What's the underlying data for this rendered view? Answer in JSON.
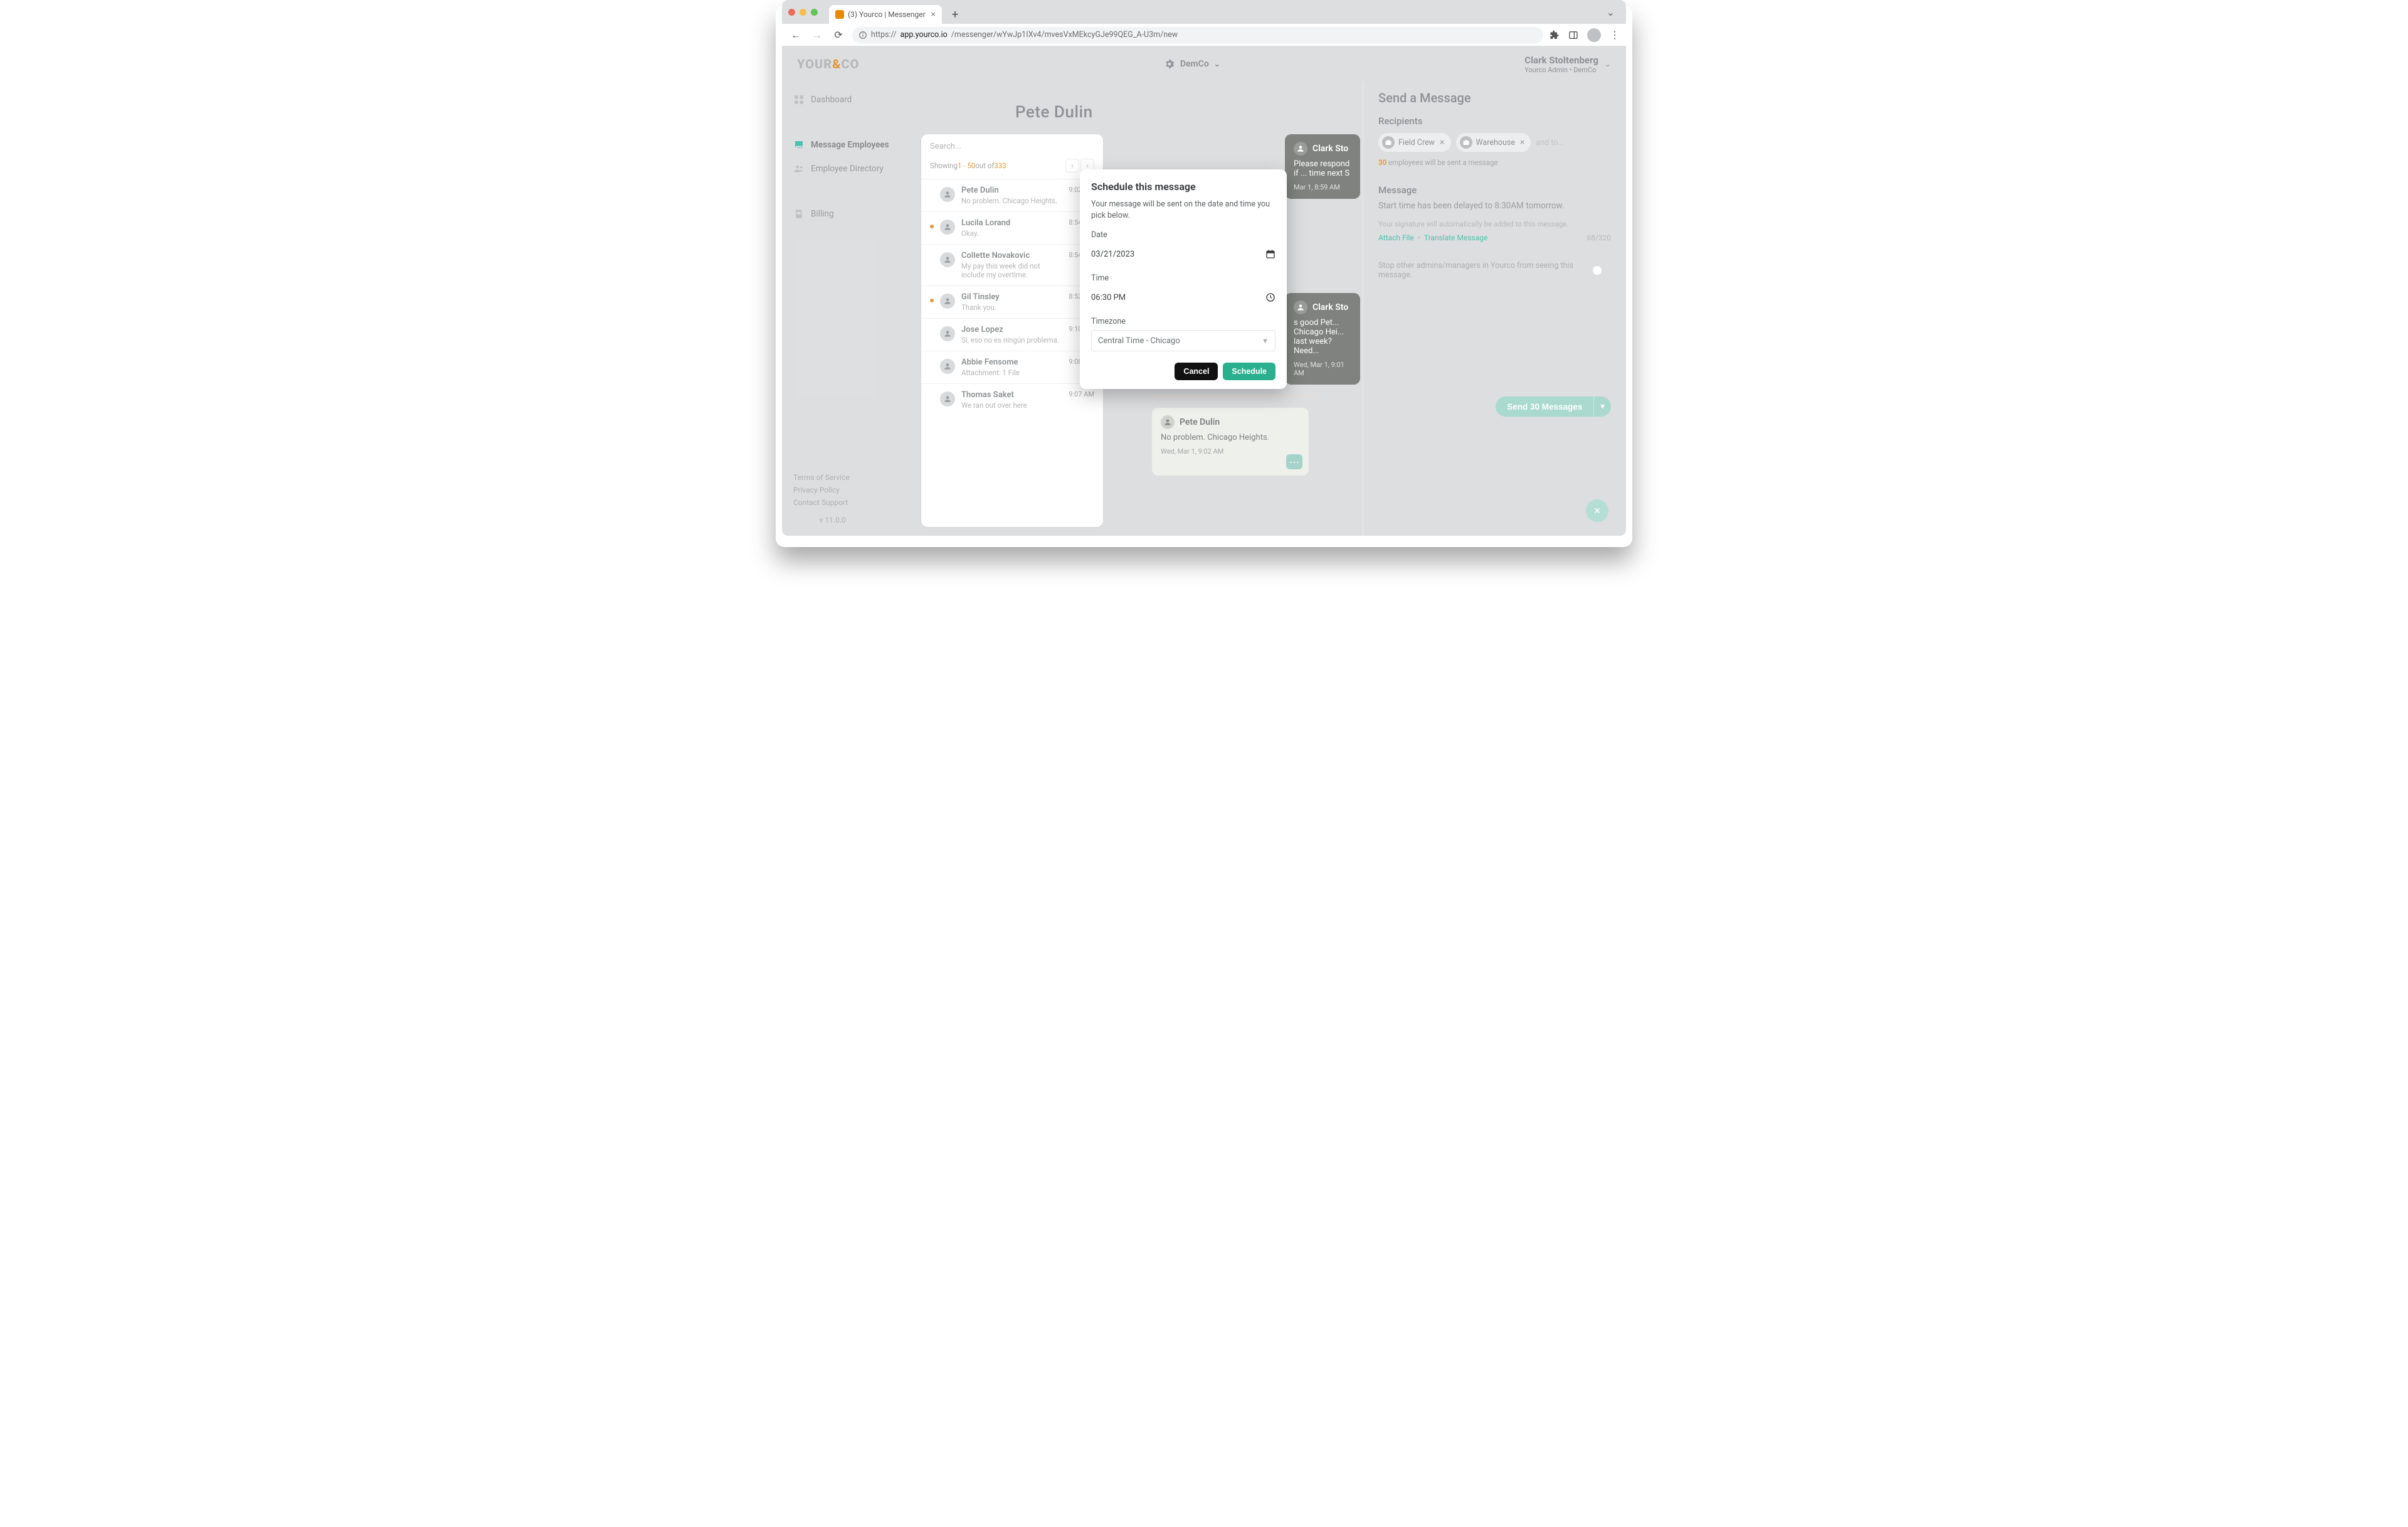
{
  "browser": {
    "tab_title": "(3) Yourco | Messenger",
    "url_proto": "https://",
    "url_host": "app.yourco.io",
    "url_path": "/messenger/wYwJp1IXv4/mvesVxMEkcyGJe99QEG_A-U3m/new"
  },
  "brand": {
    "logo_a": "YOUR",
    "logo_b": "CO",
    "accent": "&"
  },
  "company_switcher": {
    "name": "DemCo"
  },
  "user": {
    "name": "Clark Stoltenberg",
    "role": "Yourco Admin • DemCo"
  },
  "sidebar": {
    "items": [
      {
        "label": "Dashboard"
      },
      {
        "label": "Message Employees"
      },
      {
        "label": "Employee Directory"
      },
      {
        "label": "Billing"
      }
    ],
    "footer": {
      "tos": "Terms of Service",
      "privacy": "Privacy Policy",
      "contact": "Contact Support",
      "version": "v 11.0.0"
    }
  },
  "main": {
    "title": "Pete Dulin",
    "list": {
      "search_placeholder": "Search...",
      "showing_prefix": "Showing ",
      "showing_range": "1 - 50",
      "showing_mid": " out of ",
      "showing_total": "333",
      "items": [
        {
          "name": "Pete Dulin",
          "preview": "No problem. Chicago Heights.",
          "time": "9:02 AM",
          "unread": false
        },
        {
          "name": "Lucila Lorand",
          "preview": "Okay.",
          "time": "8:54 AM",
          "unread": true
        },
        {
          "name": "Collette Novakovic",
          "preview": "My pay this week did not include my overtime.",
          "time": "8:54 AM",
          "unread": false
        },
        {
          "name": "Gil Tinsley",
          "preview": "Thank you.",
          "time": "8:52 AM",
          "unread": true
        },
        {
          "name": "Jose Lopez",
          "preview": "Sí, eso no es ningún problema.",
          "time": "9:10 AM",
          "unread": false
        },
        {
          "name": "Abbie Fensome",
          "preview": "Attachment: 1 File",
          "time": "9:08 AM",
          "unread": false
        },
        {
          "name": "Thomas Saket",
          "preview": "We ran out over here",
          "time": "9:07 AM",
          "unread": false
        }
      ]
    },
    "chat": {
      "out1": {
        "sender": "Clark Sto",
        "body": "Please respond if ... time next S",
        "time": "Mar 1, 8:59 AM"
      },
      "out2": {
        "sender": "Clark Sto",
        "body": "s good Pet... Chicago Hei... last week? Need...",
        "time": "Wed, Mar 1, 9:01 AM"
      },
      "in1": {
        "sender": "Pete Dulin",
        "body": "No problem. Chicago Heights.",
        "time": "Wed, Mar 1, 9:02 AM"
      }
    }
  },
  "compose": {
    "title": "Send a Message",
    "recipients_label": "Recipients",
    "chips": [
      {
        "label": "Field Crew"
      },
      {
        "label": "Warehouse"
      }
    ],
    "chips_more": "and to...",
    "recipient_count": "30",
    "recipient_note_suffix": " employees will be sent a message",
    "message_label": "Message",
    "message_body": "Start time has been delayed to 8:30AM tomorrow.",
    "signature_hint": "Your signature will automatically be added to this message.",
    "attach": "Attach File",
    "translate": "Translate Message",
    "counter": "68/320",
    "privacy_toggle_label": "Stop other admins/managers in Yourco from seeing this message.",
    "send_label": "Send 30 Messages"
  },
  "modal": {
    "title": "Schedule this message",
    "desc": "Your message will be sent on the date and time you pick below.",
    "date_label": "Date",
    "date_value": "03/21/2023",
    "time_label": "Time",
    "time_value": "06:30 PM",
    "tz_label": "Timezone",
    "tz_value": "Central Time - Chicago",
    "cancel": "Cancel",
    "schedule": "Schedule"
  }
}
